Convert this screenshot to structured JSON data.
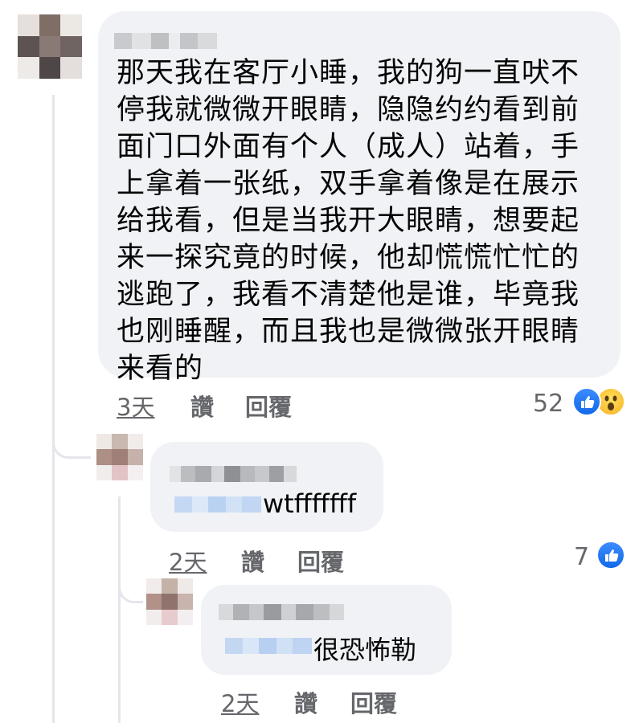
{
  "comment": {
    "text": "那天我在客厅小睡，我的狗一直吠不\n停我就微微开眼睛，隐隐约约看到前\n面门口外面有个人（成人）站着，手\n上拿着一张纸，双手拿着像是在展示\n给我看，但是当我开大眼睛，想要起\n来一探究竟的时候，他却慌慌忙忙的\n逃跑了，我看不清楚他是谁，毕竟我\n也刚睡醒，而且我也是微微张开眼睛\n来看的",
    "time": "3天",
    "like_label": "讚",
    "reply_label": "回覆",
    "reaction_count": "52",
    "reaction_icons": [
      "like-icon",
      "wow-icon"
    ]
  },
  "replies": [
    {
      "text": "wtfffffff",
      "time": "2天",
      "like_label": "讚",
      "reply_label": "回覆",
      "reaction_count": "7",
      "reaction_icons": [
        "like-icon"
      ]
    },
    {
      "text": "很恐怖勒",
      "time": "2天",
      "like_label": "讚",
      "reply_label": "回覆"
    }
  ],
  "colors": {
    "bubble": "#f0f2f5",
    "meta_text": "#65676b",
    "like_blue": "#1877f2",
    "wow_yellow": "#f7b125",
    "thread_line": "#e4e6eb"
  }
}
